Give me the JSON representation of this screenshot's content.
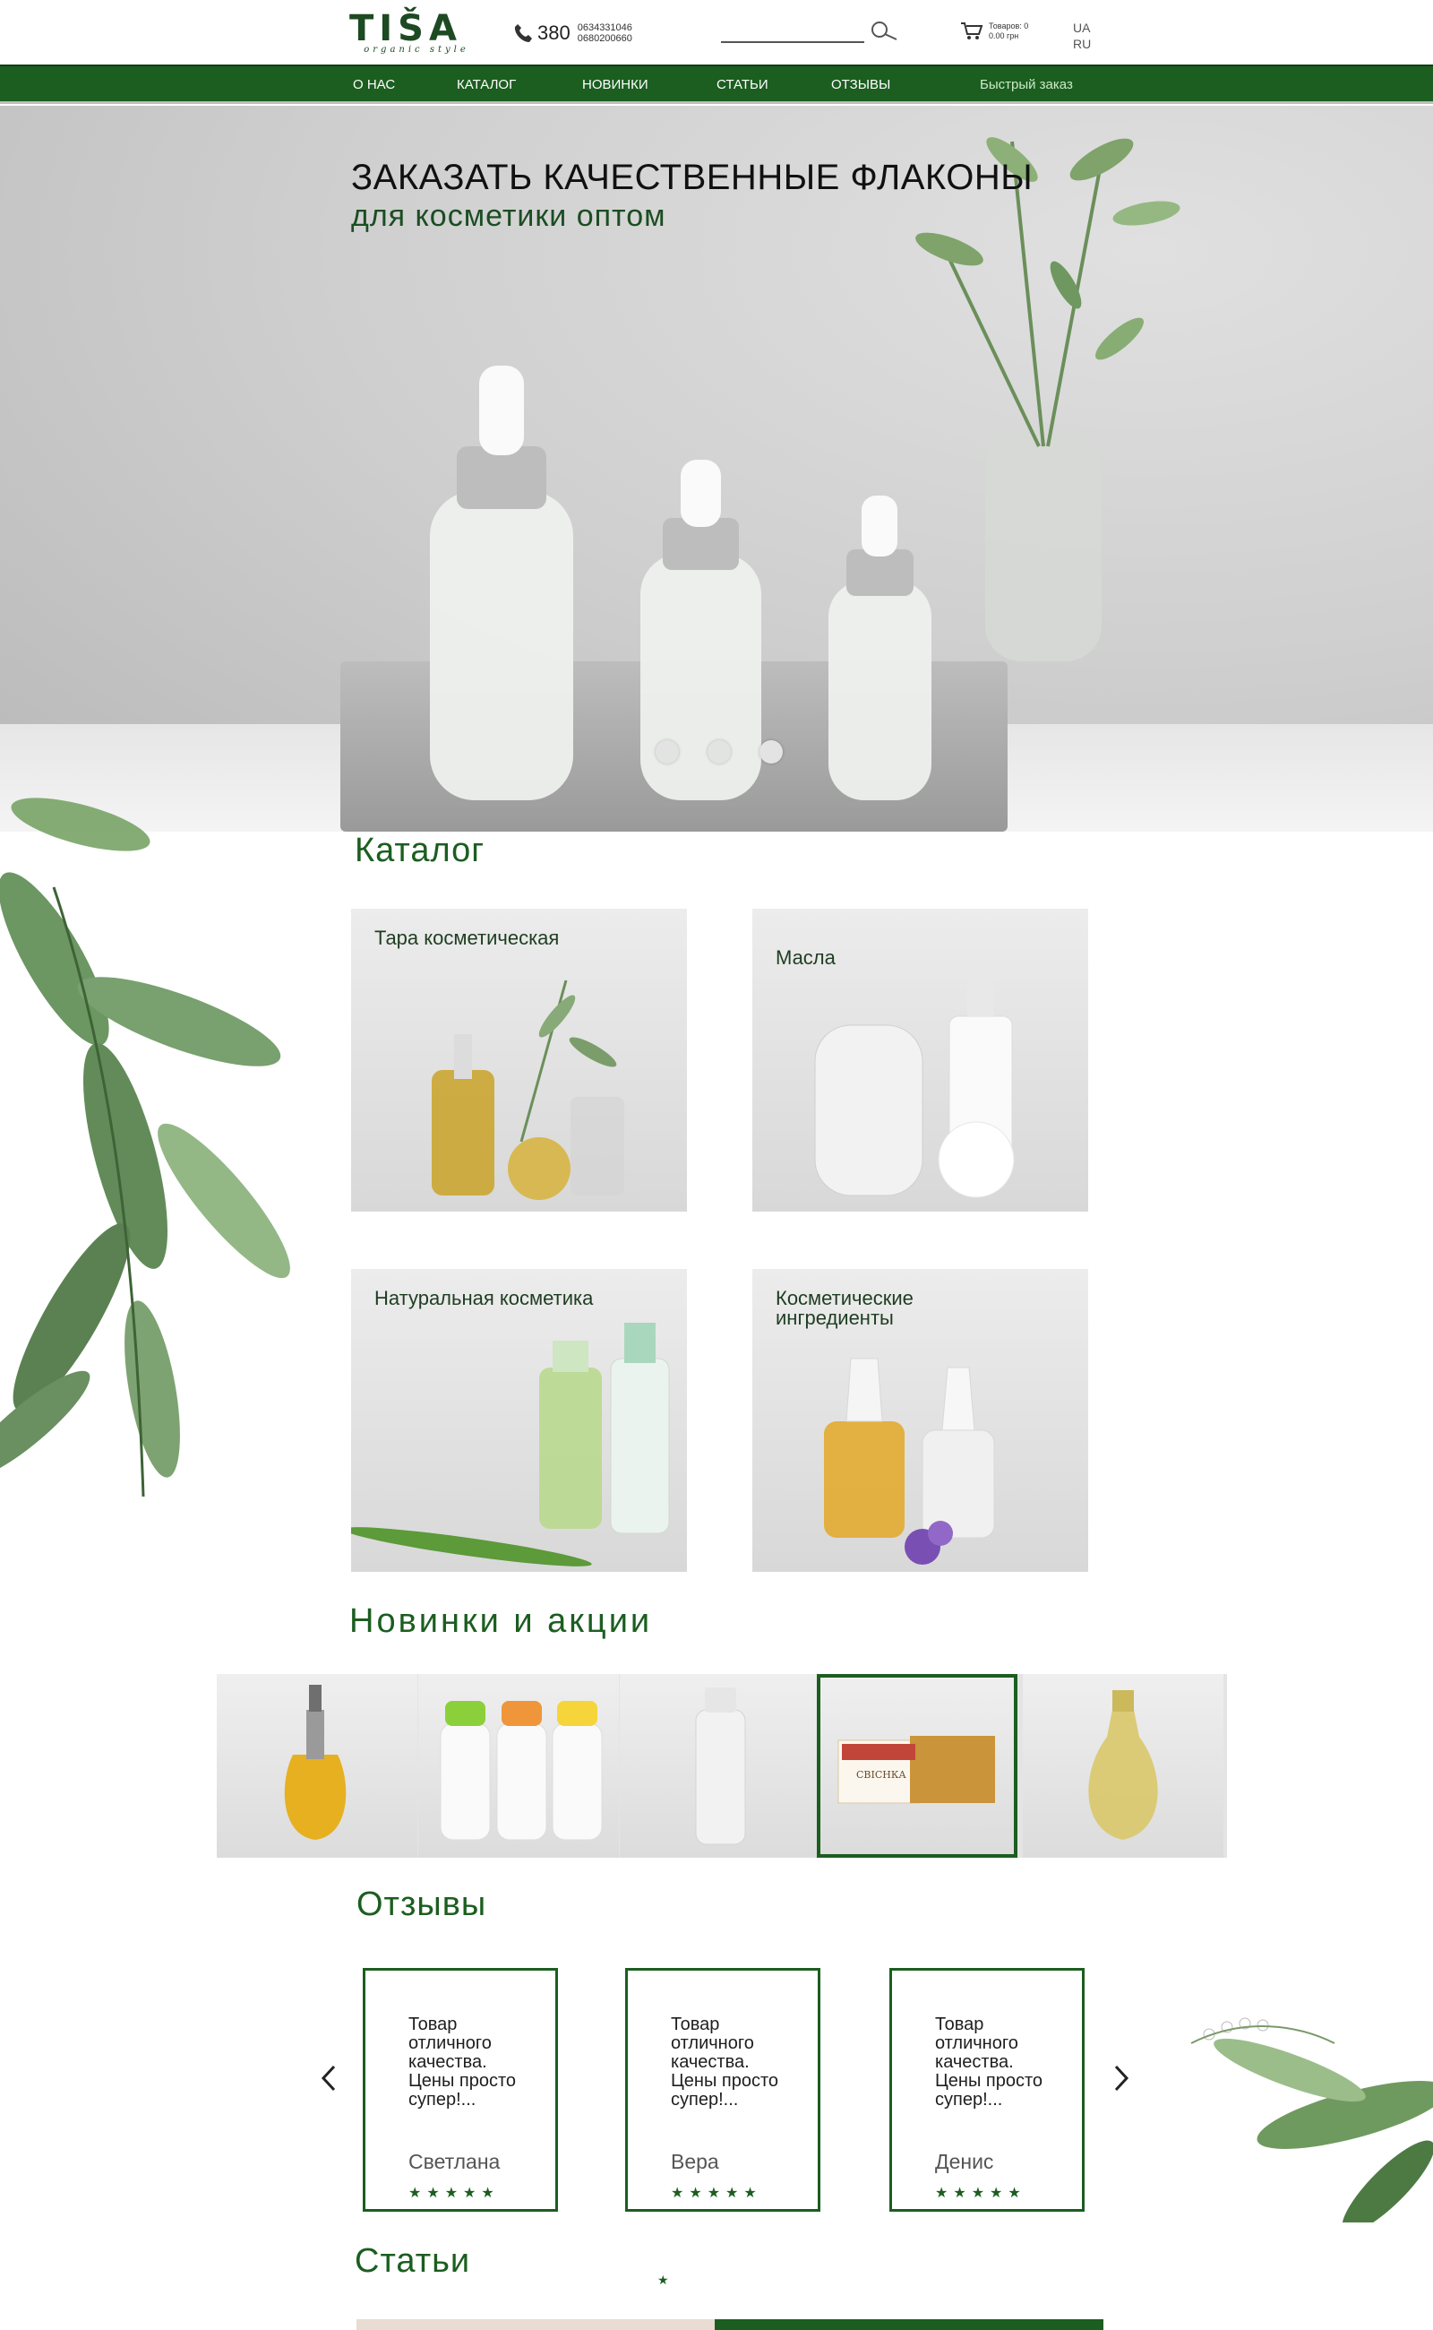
{
  "header": {
    "logo": "TIŠA",
    "logo_sub": "organic style",
    "phone_code": "380",
    "phones": [
      "0634331046",
      "0680200660"
    ],
    "search_placeholder": "",
    "cart_line1": "Товаров: 0",
    "cart_line2": "0.00 грн",
    "languages": [
      "UA",
      "RU"
    ]
  },
  "nav": {
    "items": [
      "О НАС",
      "КАТАЛОГ",
      "НОВИНКИ",
      "СТАТЬИ",
      "ОТЗЫВЫ"
    ],
    "quick_order": "Быстрый заказ"
  },
  "hero": {
    "title": "ЗАКАЗАТЬ КАЧЕСТВЕННЫЕ ФЛАКОНЫ",
    "subtitle": "для косметики оптом",
    "slides": 3
  },
  "catalog": {
    "title": "Каталог",
    "items": [
      {
        "label": "Тара косметическая"
      },
      {
        "label": "Масла"
      },
      {
        "label": "Натуральная косметика"
      },
      {
        "label": "Косметические ингредиенты"
      }
    ]
  },
  "new_items": {
    "title": "Новинки и акции",
    "product_image_text": "СВІСНКА"
  },
  "reviews": {
    "title": "Отзывы",
    "items": [
      {
        "text": "Товар отличного качества. Цены просто супер!...",
        "name": "Светлана",
        "stars": "★★★★★"
      },
      {
        "text": "Товар отличного качества. Цены просто супер!...",
        "name": "Вера",
        "stars": "★★★★★"
      },
      {
        "text": "Товар отличного качества. Цены просто супер!...",
        "name": "Денис",
        "stars": "★★★★★"
      }
    ],
    "prev_arrow": "‹",
    "next_arrow": "›"
  },
  "articles": {
    "title": "Статьи",
    "star": "★"
  },
  "colors": {
    "brand_green": "#1b5e20",
    "nav_text": "#ffffff",
    "accent_light": "#cde9c8"
  }
}
